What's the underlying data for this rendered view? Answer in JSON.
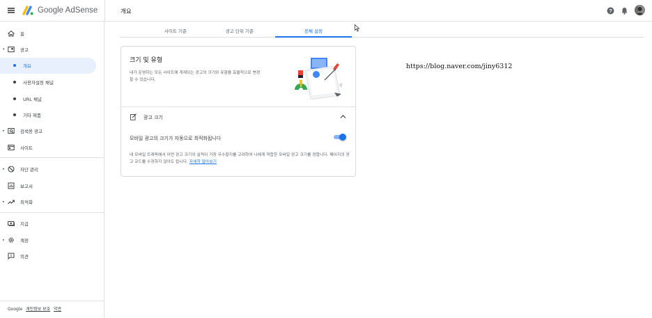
{
  "header": {
    "brand": "Google AdSense",
    "page_title": "개요",
    "icons": [
      "menu-icon",
      "adsense-logo",
      "help-icon",
      "notifications-icon",
      "avatar"
    ]
  },
  "sidebar": {
    "items": [
      {
        "label": "홈",
        "icon": "home-icon"
      },
      {
        "label": "광고",
        "icon": "ads-icon"
      },
      {
        "label": "개요",
        "sub": true,
        "active": true
      },
      {
        "label": "사용자설정 채널",
        "sub": true
      },
      {
        "label": "URL 채널",
        "sub": true
      },
      {
        "label": "기타 제품",
        "sub": true
      },
      {
        "label": "검색용 광고",
        "icon": "search-ads-icon"
      },
      {
        "label": "사이트",
        "icon": "sites-icon"
      },
      {
        "label": "차단 관리",
        "icon": "block-icon"
      },
      {
        "label": "보고서",
        "icon": "reports-icon"
      },
      {
        "label": "최적화",
        "icon": "optimization-icon"
      },
      {
        "label": "지급",
        "icon": "payments-icon"
      },
      {
        "label": "계정",
        "icon": "account-gear-icon"
      },
      {
        "label": "의견",
        "icon": "feedback-icon"
      }
    ],
    "footer": {
      "google": "Google",
      "privacy": "개인정보 보호",
      "terms": "약관"
    }
  },
  "tabs": [
    {
      "label": "사이트 기준",
      "active": false
    },
    {
      "label": "광고 단위 기준",
      "active": false
    },
    {
      "label": "전체 설정",
      "active": true
    }
  ],
  "card": {
    "title": "크기 및 유형",
    "description": "내가 운영하는 모든 사이트에 게재되는 광고의 크기와 유형을 효율적으로 변경할 수 있습니다.",
    "section_title": "광고 크기",
    "toggle_label": "모바일 광고의 크기가 자동으로 최적화됩니다",
    "toggle_on": true,
    "note": "내 모바일 트래픽에서 어떤 광고 크기의 실적이 가장 우수할지를 고려하여 나에게 적합한 모바일 광고 크기를 정합니다. 페이지의 광고 코드를 수정하지 않아도 됩니다.",
    "learn_more": "자세히 알아보기"
  },
  "watermark": "https://blog.naver.com/jiny6312",
  "colors": {
    "accent": "#1a73e8",
    "active_bg": "#e8f0fe",
    "toggle_track": "#8ab4f8"
  }
}
